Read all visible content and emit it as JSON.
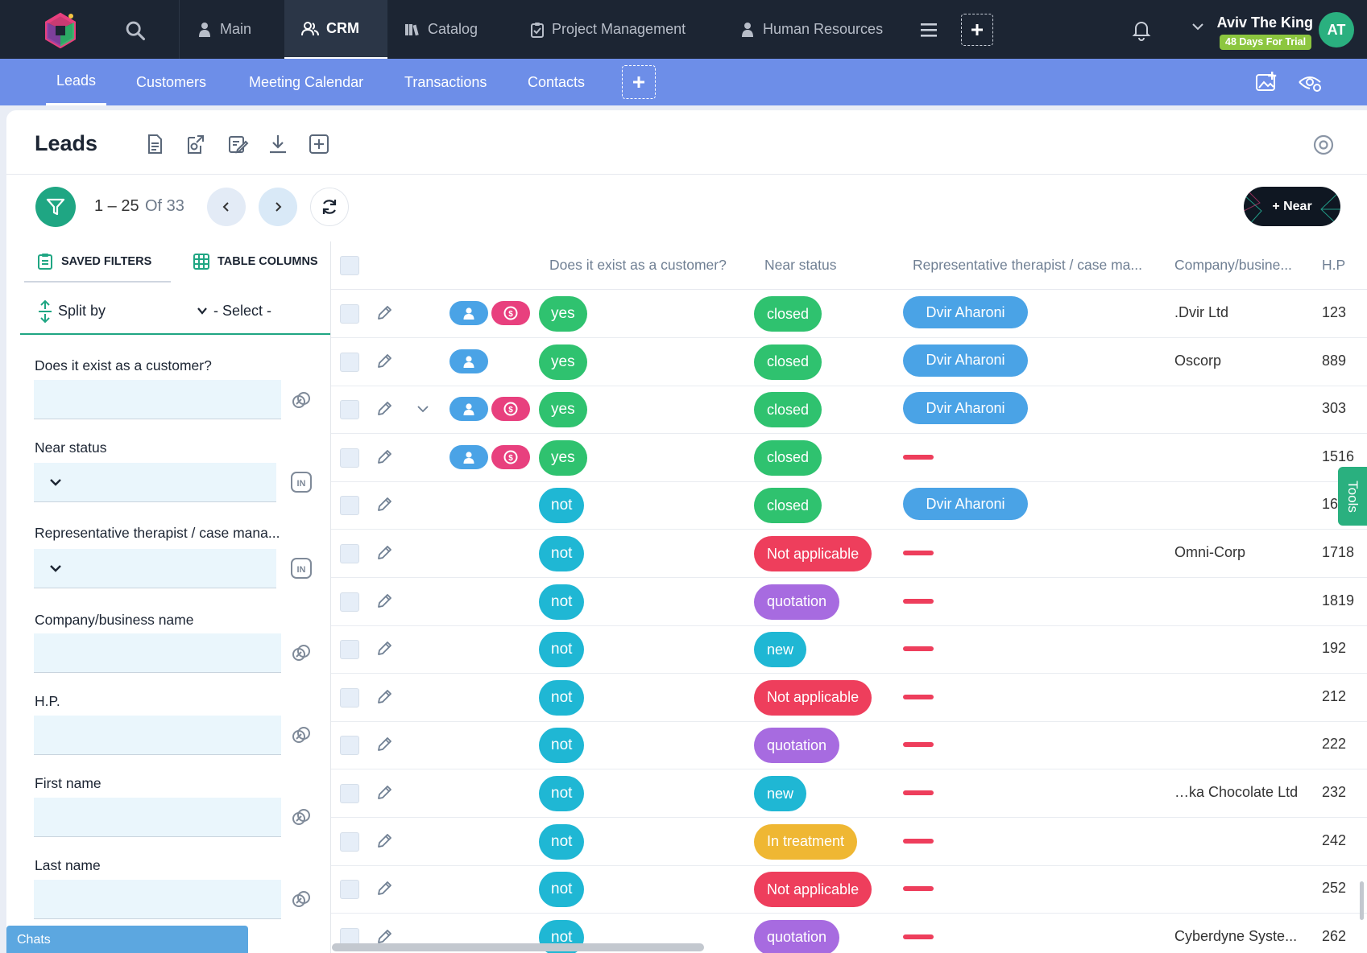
{
  "topnav": {
    "items": [
      {
        "label": "Main"
      },
      {
        "label": "CRM"
      },
      {
        "label": "Catalog"
      },
      {
        "label": "Project Management"
      },
      {
        "label": "Human Resources"
      }
    ],
    "user_name": "Aviv The King",
    "trial_badge": "48 Days For Trial",
    "avatar_initials": "AT"
  },
  "subnav": {
    "items": [
      {
        "label": "Leads"
      },
      {
        "label": "Customers"
      },
      {
        "label": "Meeting Calendar"
      },
      {
        "label": "Transactions"
      },
      {
        "label": "Contacts"
      }
    ]
  },
  "page": {
    "title": "Leads"
  },
  "pagination": {
    "range": "1 – 25",
    "of": "Of 33"
  },
  "near_button": "+ Near",
  "sidebar": {
    "tabs": [
      "SAVED FILTERS",
      "TABLE COLUMNS"
    ],
    "split_by": "Split by",
    "split_select": "- Select -",
    "filters": [
      {
        "label": "Does it exist as a customer?"
      },
      {
        "label": "Near status"
      },
      {
        "label": "Representative therapist / case mana..."
      },
      {
        "label": "Company/business name"
      },
      {
        "label": "H.P."
      },
      {
        "label": "First name"
      },
      {
        "label": "Last name"
      }
    ],
    "chats": "Chats"
  },
  "table": {
    "columns": [
      "Does it exist as a customer?",
      "Near status",
      "Representative therapist / case ma...",
      "Company/busine...",
      "H.P"
    ],
    "rows": [
      {
        "actions": [
          "person",
          "money"
        ],
        "exist": "yes",
        "status": "closed",
        "rep": "Dvir Aharoni",
        "company": ".Dvir Ltd",
        "hp": "123"
      },
      {
        "actions": [
          "person"
        ],
        "exist": "yes",
        "status": "closed",
        "rep": "Dvir Aharoni",
        "company": "Oscorp",
        "hp": "889"
      },
      {
        "actions": [
          "person",
          "money"
        ],
        "expand": true,
        "exist": "yes",
        "status": "closed",
        "rep": "Dvir Aharoni",
        "company": "",
        "hp": "303"
      },
      {
        "actions": [
          "person",
          "money"
        ],
        "exist": "yes",
        "status": "closed",
        "rep": "",
        "company": "",
        "hp": "1516"
      },
      {
        "actions": [],
        "exist": "not",
        "status": "closed",
        "rep": "Dvir Aharoni",
        "company": "",
        "hp": "161"
      },
      {
        "actions": [],
        "exist": "not",
        "status": "Not applicable",
        "rep": "",
        "company": "Omni-Corp",
        "hp": "1718"
      },
      {
        "actions": [],
        "exist": "not",
        "status": "quotation",
        "rep": "",
        "company": "",
        "hp": "1819"
      },
      {
        "actions": [],
        "exist": "not",
        "status": "new",
        "rep": "",
        "company": "",
        "hp": "192"
      },
      {
        "actions": [],
        "exist": "not",
        "status": "Not applicable",
        "rep": "",
        "company": "",
        "hp": "212"
      },
      {
        "actions": [],
        "exist": "not",
        "status": "quotation",
        "rep": "",
        "company": "",
        "hp": "222"
      },
      {
        "actions": [],
        "exist": "not",
        "status": "new",
        "rep": "",
        "company": "…ka Chocolate Ltd",
        "hp": "232"
      },
      {
        "actions": [],
        "exist": "not",
        "status": "In treatment",
        "rep": "",
        "company": "",
        "hp": "242"
      },
      {
        "actions": [],
        "exist": "not",
        "status": "Not applicable",
        "rep": "",
        "company": "",
        "hp": "252"
      },
      {
        "actions": [],
        "exist": "not",
        "status": "quotation",
        "rep": "",
        "company": "Cyberdyne Syste...",
        "hp": "262"
      }
    ]
  },
  "tools_tab": "Tools",
  "colors": {
    "yes": "#2fc26f",
    "not": "#1fb7d4",
    "closed": "#2fc26f",
    "Not applicable": "#ee3e5c",
    "quotation": "#a76be0",
    "new": "#1fb7d4",
    "In treatment": "#efb733"
  }
}
